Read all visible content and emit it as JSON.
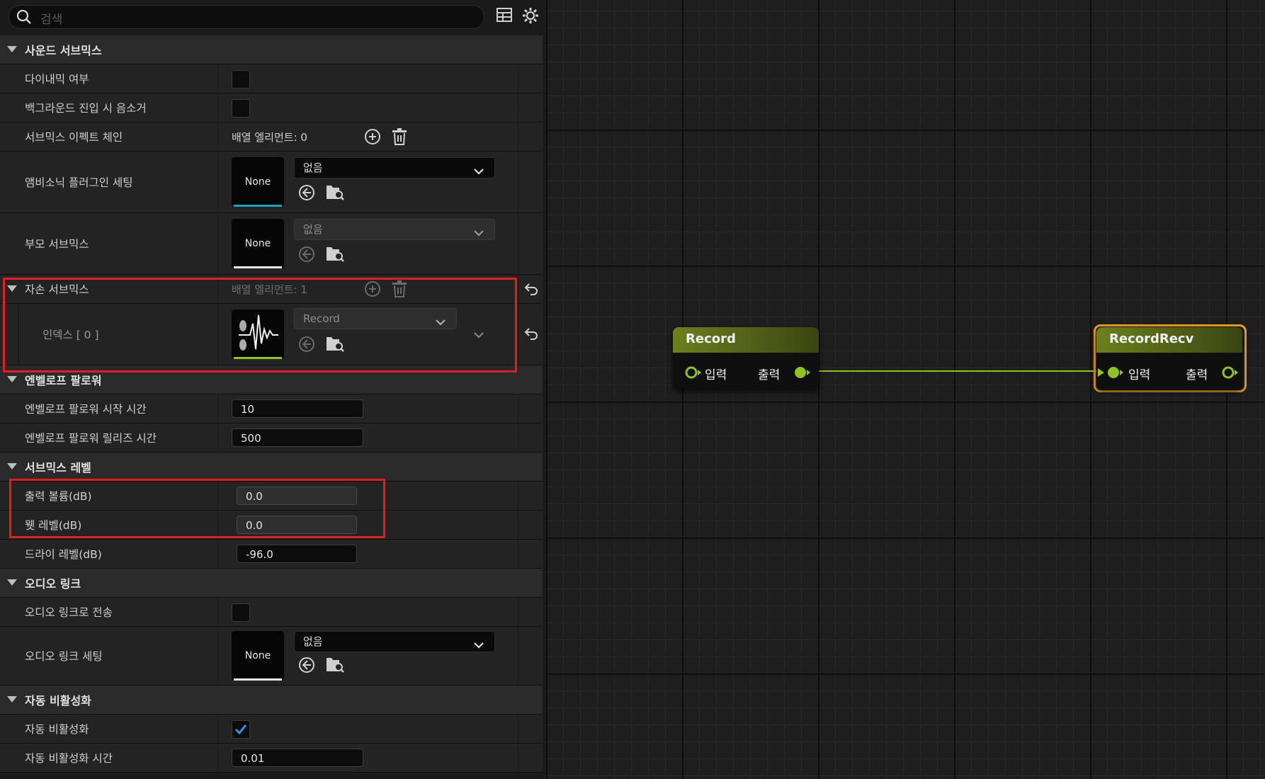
{
  "search": {
    "placeholder": "검색"
  },
  "colors": {
    "accent_green": "#8fc31f",
    "selection_orange": "#f0a020",
    "highlight_red": "#e02020",
    "thumb_blue": "#1fa0c0"
  },
  "sections": {
    "sound_submix": {
      "title": "사운드 서브믹스",
      "dynamic": {
        "label": "다이내믹 여부",
        "checked": false
      },
      "mute_bg": {
        "label": "백그라운드 진입 시 음소거",
        "checked": false
      },
      "effect_chain": {
        "label": "서브믹스 이펙트 체인",
        "value": "배열 엘리먼트: 0"
      },
      "ambisonics": {
        "label": "앰비소닉 플러그인 세팅",
        "thumb": "None",
        "combo": "없음"
      },
      "parent": {
        "label": "부모 서브믹스",
        "thumb": "None",
        "combo": "없음"
      },
      "children": {
        "label": "자손 서브믹스",
        "value": "배열 엘리먼트: 1"
      },
      "child_index": {
        "label": "인덱스 [ 0 ]",
        "combo": "Record"
      }
    },
    "envelope": {
      "title": "엔벨로프 팔로워",
      "attack": {
        "label": "엔벨로프 팔로워 시작 시간",
        "value": "10"
      },
      "release": {
        "label": "엔벨로프 팔로워 릴리즈 시간",
        "value": "500"
      }
    },
    "levels": {
      "title": "서브믹스 레벨",
      "output": {
        "label": "출력 볼륨(dB)",
        "value": "0.0"
      },
      "wet": {
        "label": "웻 레벨(dB)",
        "value": "0.0"
      },
      "dry": {
        "label": "드라이 레벨(dB)",
        "value": "-96.0"
      }
    },
    "audio_link": {
      "title": "오디오 링크",
      "send": {
        "label": "오디오 링크로 전송",
        "checked": false
      },
      "settings": {
        "label": "오디오 링크 세팅",
        "thumb": "None",
        "combo": "없음"
      }
    },
    "auto_disable": {
      "title": "자동 비활성화",
      "enabled": {
        "label": "자동 비활성화",
        "checked": true
      },
      "time": {
        "label": "자동 비활성화 시간",
        "value": "0.01"
      }
    }
  },
  "graph": {
    "nodes": [
      {
        "title": "Record",
        "input": "입력",
        "output": "출력",
        "selected": false
      },
      {
        "title": "RecordRecv",
        "input": "입력",
        "output": "출력",
        "selected": true
      }
    ]
  }
}
